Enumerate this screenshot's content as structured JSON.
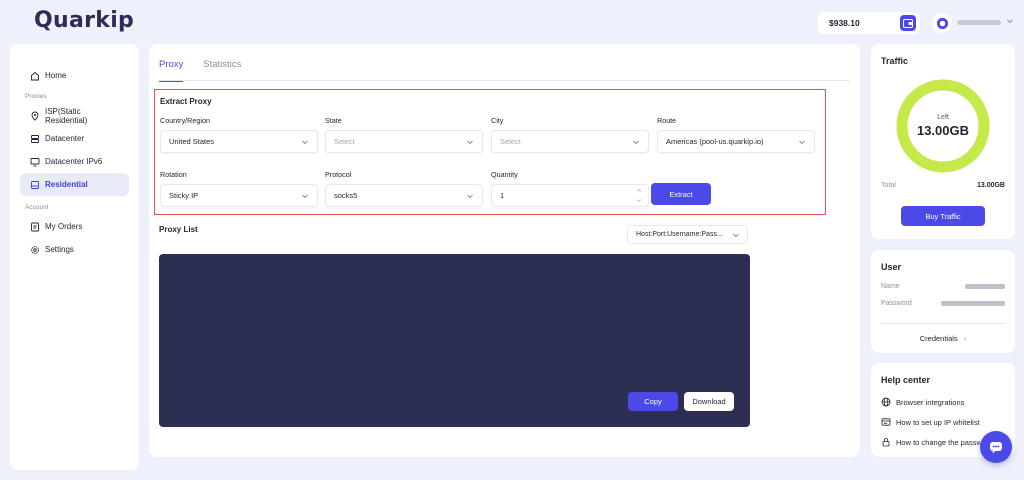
{
  "app": {
    "logo_text": "uarkip",
    "logo_letter": "Q"
  },
  "header": {
    "balance": "$938.10"
  },
  "sidebar": {
    "home": "Home",
    "proxies_section": "Proxies",
    "proxies": [
      "ISP(Static Residential)",
      "Datacenter",
      "Datacenter IPv6",
      "Residential"
    ],
    "account_section": "Account",
    "account": [
      "My Orders",
      "Settings"
    ]
  },
  "tabs": [
    "Proxy",
    "Statistics"
  ],
  "extract": {
    "title": "Extract Proxy",
    "country_label": "Country/Region",
    "country_value": "United States",
    "state_label": "State",
    "state_placeholder": "Select",
    "city_label": "City",
    "city_placeholder": "Select",
    "route_label": "Route",
    "route_value": "Americas (pool-us.quarkip.io)",
    "rotation_label": "Rotation",
    "rotation_value": "Sticky IP",
    "protocol_label": "Protocol",
    "protocol_value": "socks5",
    "quantity_label": "Quantity",
    "quantity_value": "1",
    "extract_button": "Extract"
  },
  "proxy_list": {
    "title": "Proxy List",
    "format": "Host:Port:Username:Pass...",
    "copy_button": "Copy",
    "download_button": "Download"
  },
  "traffic": {
    "title": "Traffic",
    "left_label": "Left",
    "left_value": "13.00GB",
    "remaining_fraction": 1.0,
    "total_label": "Total",
    "total_value": "13.00GB",
    "buy_button": "Buy Traffic"
  },
  "user": {
    "title": "User",
    "name_label": "Name",
    "password_label": "Password",
    "credentials_link": "Credentials"
  },
  "help": {
    "title": "Help center",
    "items": [
      "Browser integrations",
      "How to set up IP whitelist",
      "How to change the password"
    ]
  },
  "colors": {
    "accent": "#4b4ae8",
    "ring": "#c5e84a",
    "output_bg": "#2d2f52",
    "highlight_border": "#e2574c"
  }
}
